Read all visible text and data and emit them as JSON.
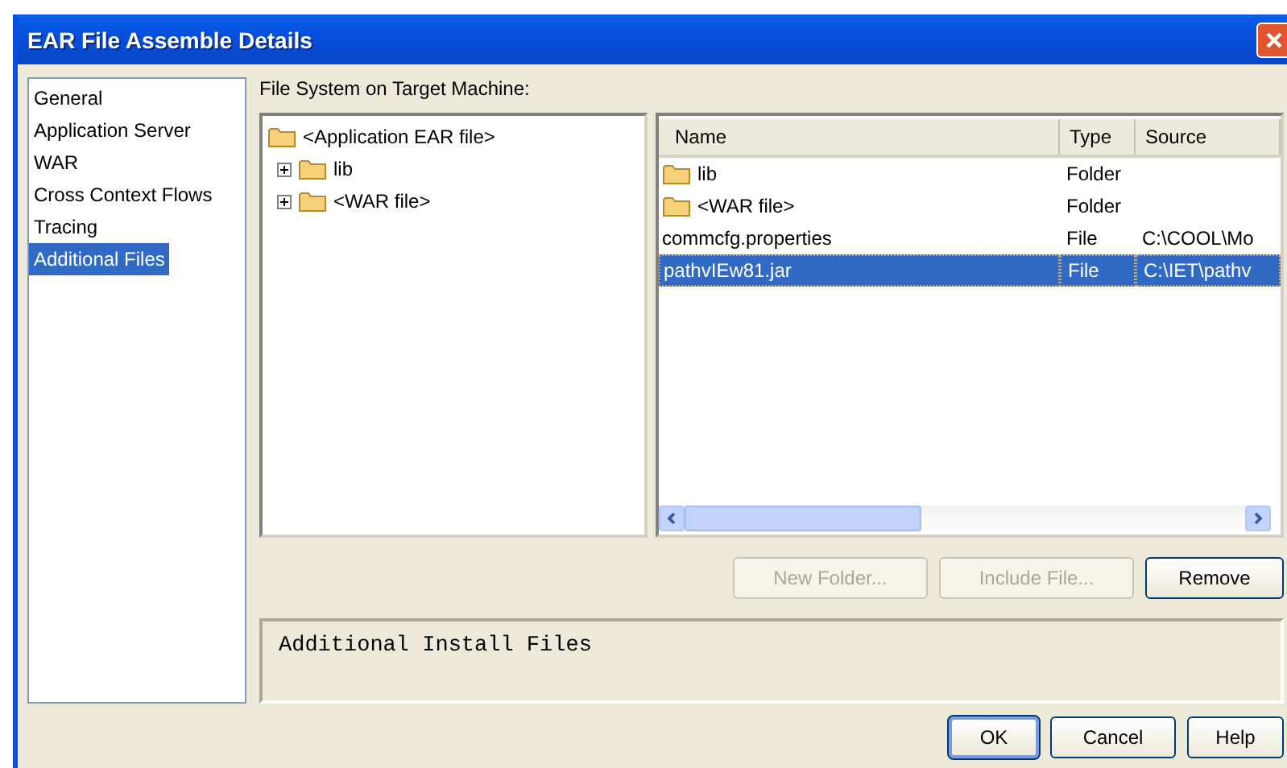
{
  "window": {
    "title": "EAR File Assemble Details"
  },
  "sidebar": {
    "items": [
      {
        "label": "General",
        "selected": false
      },
      {
        "label": "Application Server",
        "selected": false
      },
      {
        "label": "WAR",
        "selected": false
      },
      {
        "label": "Cross Context Flows",
        "selected": false
      },
      {
        "label": "Tracing",
        "selected": false
      },
      {
        "label": "Additional Files",
        "selected": true
      }
    ]
  },
  "file_system": {
    "label": "File System on Target Machine:",
    "tree": [
      {
        "label": "<Application EAR file>",
        "children": [
          {
            "label": "lib",
            "expanded": false
          },
          {
            "label": "<WAR file>",
            "expanded": false
          }
        ]
      }
    ]
  },
  "table": {
    "columns": [
      "Name",
      "Type",
      "Source"
    ],
    "rows": [
      {
        "kind": "folder",
        "name": "lib",
        "type": "Folder",
        "source": "",
        "selected": false
      },
      {
        "kind": "folder",
        "name": "<WAR file>",
        "type": "Folder",
        "source": "",
        "selected": false
      },
      {
        "kind": "file",
        "name": "commcfg.properties",
        "type": "File",
        "source": "C:\\COOL\\Mo",
        "selected": false
      },
      {
        "kind": "file",
        "name": "pathvIEw81.jar",
        "type": "File",
        "source": "C:\\IET\\pathv",
        "selected": true
      }
    ]
  },
  "file_buttons": [
    {
      "label": "New Folder...",
      "disabled": true
    },
    {
      "label": "Include File...",
      "disabled": true
    },
    {
      "label": "Remove",
      "disabled": false
    }
  ],
  "description": "Additional Install Files",
  "dialog_buttons": [
    {
      "label": "OK",
      "default": true
    },
    {
      "label": "Cancel",
      "default": false
    },
    {
      "label": "Help",
      "default": false
    }
  ]
}
